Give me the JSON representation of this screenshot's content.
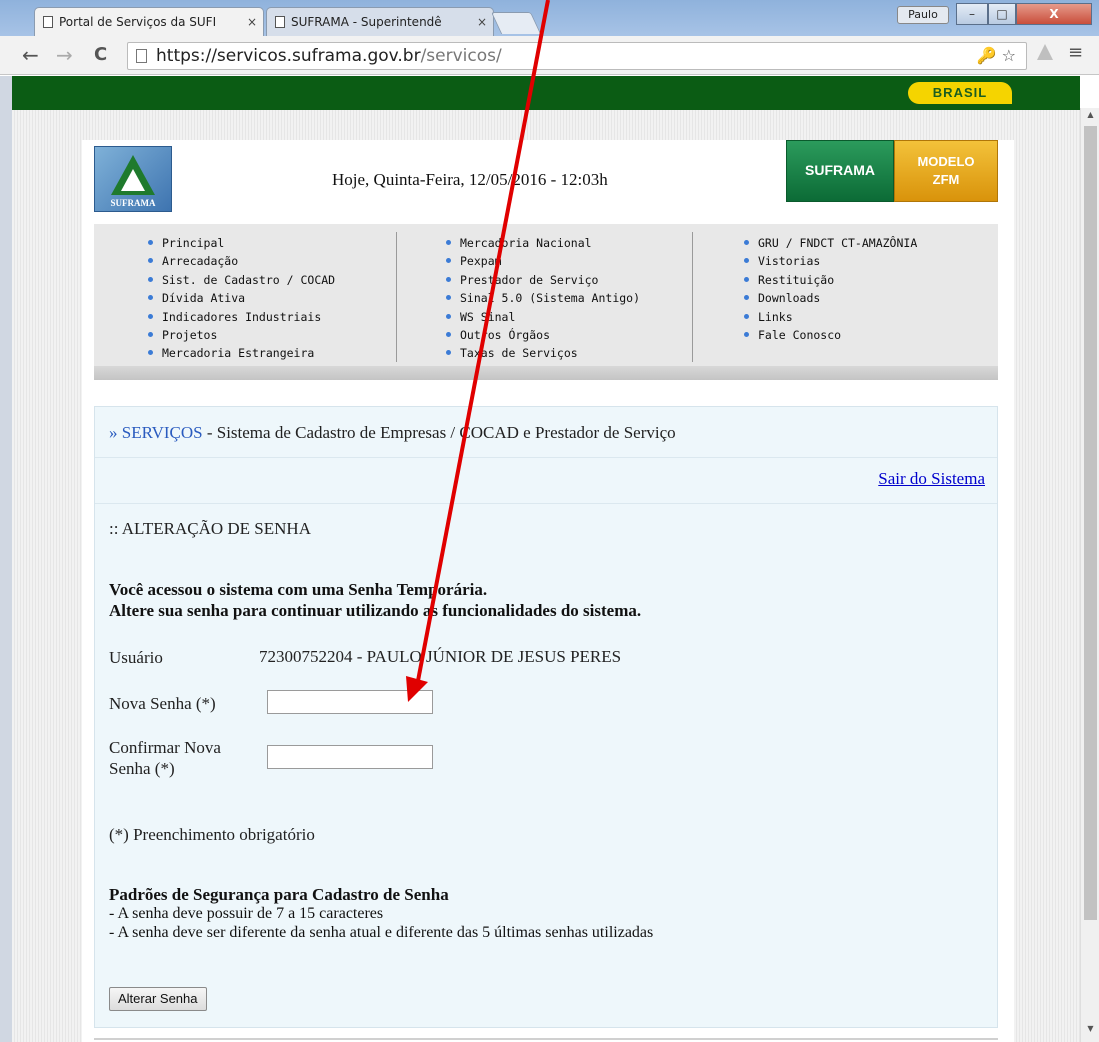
{
  "browser": {
    "tabs": [
      {
        "title": "Portal de Serviços da SUFI",
        "close": "×"
      },
      {
        "title": "SUFRAMA - Superintendê",
        "close": "×"
      }
    ],
    "user_button": "Paulo",
    "window_buttons": {
      "minimize": "–",
      "maximize": "□",
      "close": "X"
    },
    "nav": {
      "back": "←",
      "forward": "→",
      "reload": "C"
    },
    "url": {
      "host": "https://servicos.suframa.gov.br",
      "path": "/servicos/"
    },
    "omnibox_icons": "🔑 ☆",
    "menu": "≡"
  },
  "gov_bar": {
    "badge": "BRASIL"
  },
  "header": {
    "logo_text": "SUFRAMA",
    "date_line": "Hoje, Quinta-Feira, 12/05/2016 - 12:03h",
    "suframa_button": "SUFRAMA",
    "zfm_button_line1": "MODELO",
    "zfm_button_line2": "ZFM"
  },
  "nav_menu": {
    "col1": [
      "Principal",
      "Arrecadação",
      "Sist. de Cadastro / COCAD",
      "Dívida Ativa",
      "Indicadores Industriais",
      "Projetos",
      "Mercadoria Estrangeira"
    ],
    "col2": [
      "Mercadoria Nacional",
      "Pexpam",
      "Prestador de Serviço",
      "Sinal 5.0 (Sistema Antigo)",
      "WS Sinal",
      "Outros Órgãos",
      "Taxas de Serviços"
    ],
    "col3": [
      "GRU / FNDCT CT-AMAZÔNIA",
      "Vistorias",
      "Restituição",
      "Downloads",
      "Links",
      "Fale Conosco"
    ]
  },
  "content": {
    "breadcrumb_link": "» SERVIÇOS",
    "breadcrumb_text": " - Sistema de Cadastro de Empresas / COCAD e Prestador de Serviço",
    "logout": "Sair do Sistema",
    "section_title": ":: ALTERAÇÃO DE SENHA",
    "notice_line1": "Você acessou o sistema com uma Senha Temporária.",
    "notice_line2": "Altere sua senha para continuar utilizando as funcionalidades do sistema.",
    "user_label": "Usuário",
    "user_value": "72300752204 - PAULO JÚNIOR DE JESUS PERES",
    "new_password_label": "Nova Senha (*)",
    "new_password_value": "",
    "confirm_label_line1": "Confirmar Nova",
    "confirm_label_line2": "Senha (*)",
    "confirm_value": "",
    "required_note": "(*) Preenchimento obrigatório",
    "rules_title": "Padrões de Segurança para Cadastro de Senha",
    "rule1": "- A senha deve possuir de 7 a 15 caracteres",
    "rule2": "- A senha deve ser diferente da senha atual e diferente das 5 últimas senhas utilizadas",
    "submit": "Alterar Senha"
  },
  "annotation_color": "#e00000"
}
